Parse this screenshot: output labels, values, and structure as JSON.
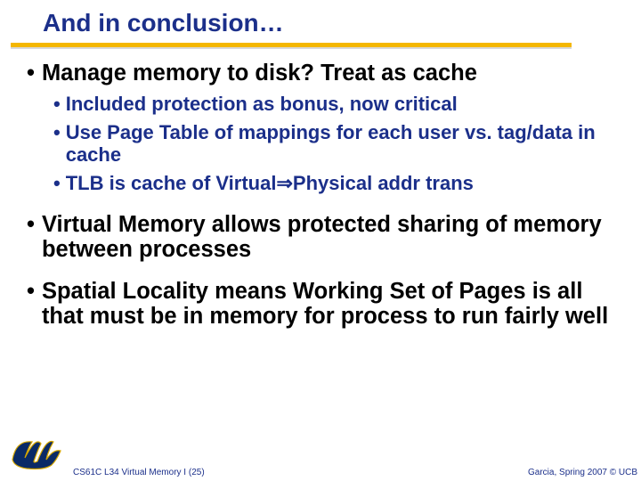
{
  "title": "And in conclusion…",
  "bullets": {
    "p1": "Manage memory to disk? Treat as cache",
    "s1": "Included protection as bonus, now critical",
    "s2a": "Use Page Table of mappings ",
    "s2b": "for each user ",
    "s2c": "vs. tag/data in cache",
    "s3a": "TLB is cache of Virtual",
    "s3arrow": "⇒",
    "s3b": "Physical addr trans",
    "p2": "Virtual Memory allows protected sharing of memory between processes",
    "p3": "Spatial Locality means Working Set of Pages is all that must be in memory for process to run fairly well"
  },
  "footer": {
    "left": "CS61C L34 Virtual Memory I (25)",
    "right": "Garcia, Spring 2007 © UCB"
  },
  "logo_alt": "Cal"
}
